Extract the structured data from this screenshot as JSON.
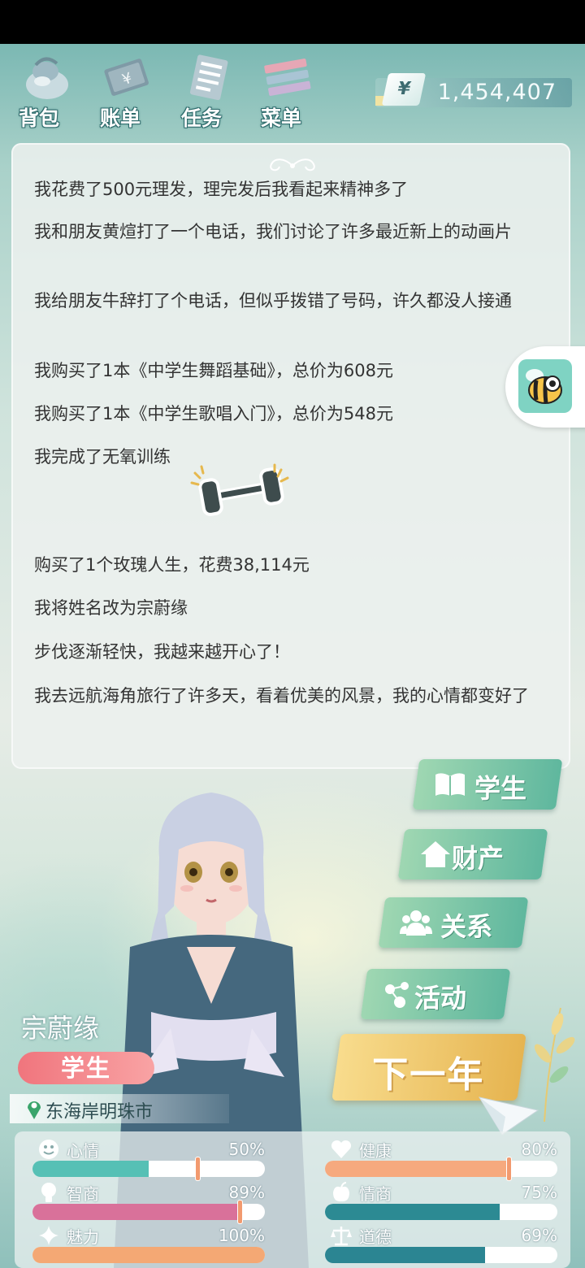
{
  "menu": [
    {
      "label": "背包",
      "icon": "bag-icon"
    },
    {
      "label": "账单",
      "icon": "bill-icon"
    },
    {
      "label": "任务",
      "icon": "task-list-icon"
    },
    {
      "label": "菜单",
      "icon": "menu-icon"
    }
  ],
  "money": {
    "symbol": "¥",
    "value": "1,454,407"
  },
  "log": [
    "我花费了500元理发，理完发后我看起来精神多了",
    "我和朋友黄煊打了一个电话，我们讨论了许多最近新上的动画片",
    "我给朋友牛辞打了个电话，但似乎拨错了号码，许久都没人接通",
    "我购买了1本《中学生舞蹈基础》，总价为608元",
    "我购买了1本《中学生歌唱入门》，总价为548元",
    "我完成了无氧训练",
    "购买了1个玫瑰人生，花费38,114元",
    "我将姓名改为宗蔚缘",
    "步伐逐渐轻快，我越来越开心了！",
    "我去远航海角旅行了许多天，看着优美的风景，我的心情都变好了"
  ],
  "categories": [
    {
      "label": "学生",
      "icon": "book-icon"
    },
    {
      "label": "财产",
      "icon": "house-icon"
    },
    {
      "label": "关系",
      "icon": "people-icon"
    },
    {
      "label": "活动",
      "icon": "activity-icon"
    }
  ],
  "next_year": "下一年",
  "character": {
    "name": "宗蔚缘",
    "status": "学生",
    "location": "东海岸明珠市"
  },
  "stats": [
    {
      "name": "心情",
      "value": "50%",
      "fraction": 0.5,
      "marker": 0.71,
      "color": "#56c0b5",
      "icon": "smiley-icon"
    },
    {
      "name": "健康",
      "value": "80%",
      "fraction": 0.8,
      "marker": 0.79,
      "color": "#f6a97e",
      "icon": "heart-icon"
    },
    {
      "name": "智商",
      "value": "89%",
      "fraction": 0.89,
      "marker": 0.89,
      "color": "#d9719a",
      "icon": "bulb-icon"
    },
    {
      "name": "情商",
      "value": "75%",
      "fraction": 0.75,
      "marker": null,
      "color": "#2c8a93",
      "icon": "apple-icon"
    },
    {
      "name": "魅力",
      "value": "100%",
      "fraction": 1.0,
      "marker": null,
      "color": "#f4a874",
      "icon": "sparkle-icon"
    },
    {
      "name": "道德",
      "value": "69%",
      "fraction": 0.69,
      "marker": null,
      "color": "#2b8592",
      "icon": "scale-icon"
    }
  ]
}
